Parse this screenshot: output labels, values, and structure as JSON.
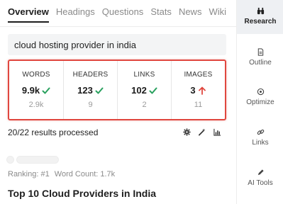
{
  "tabs": [
    "Overview",
    "Headings",
    "Questions",
    "Stats",
    "News",
    "Wiki"
  ],
  "active_tab": "Overview",
  "search": {
    "query": "cloud hosting provider in india"
  },
  "stats": [
    {
      "label": "WORDS",
      "value": "9.9k",
      "target": "2.9k",
      "status": "ok"
    },
    {
      "label": "HEADERS",
      "value": "123",
      "target": "9",
      "status": "ok"
    },
    {
      "label": "LINKS",
      "value": "102",
      "target": "2",
      "status": "ok"
    },
    {
      "label": "IMAGES",
      "value": "3",
      "target": "11",
      "status": "up"
    }
  ],
  "processed": "20/22 results processed",
  "toolbar_icons": [
    "gear-icon",
    "wand-icon",
    "chart-icon"
  ],
  "result": {
    "ranking": "Ranking: #1",
    "word_count": "Word Count: 1.7k",
    "title": "Top 10 Cloud Providers in India"
  },
  "rail": [
    {
      "label": "Research",
      "icon": "binoculars-icon",
      "active": true
    },
    {
      "label": "Outline",
      "icon": "document-icon",
      "active": false
    },
    {
      "label": "Optimize",
      "icon": "target-icon",
      "active": false
    },
    {
      "label": "Links",
      "icon": "link-icon",
      "active": false
    },
    {
      "label": "AI Tools",
      "icon": "pen-icon",
      "active": false
    }
  ],
  "colors": {
    "ok": "#2aa15f",
    "up": "#e0473f",
    "highlight": "#e0473f"
  }
}
